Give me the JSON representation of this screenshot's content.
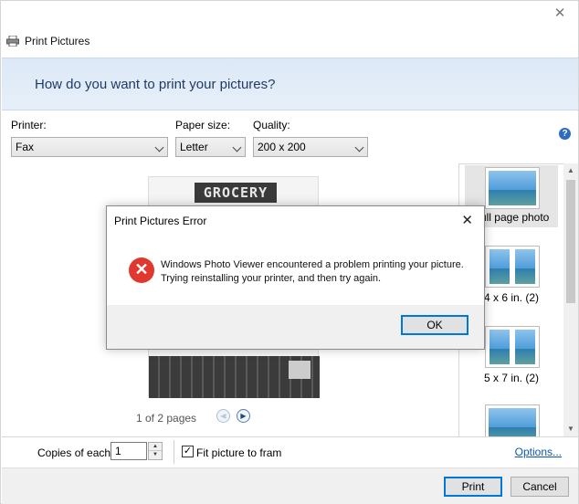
{
  "window": {
    "title": "Print Pictures",
    "close_glyph": "✕"
  },
  "banner": {
    "heading": "How do you want to print your pictures?"
  },
  "printer": {
    "label": "Printer:",
    "value": "Fax"
  },
  "paper_size": {
    "label": "Paper size:",
    "value": "Letter"
  },
  "quality": {
    "label": "Quality:",
    "value": "200 x 200"
  },
  "help": {
    "glyph": "?"
  },
  "preview": {
    "sign_text": "GROCERY",
    "page_info": "1 of 2 pages"
  },
  "layouts": [
    {
      "label": "Full page photo",
      "selected": true
    },
    {
      "label": "4 x 6 in. (2)",
      "selected": false
    },
    {
      "label": "5 x 7 in. (2)",
      "selected": false
    }
  ],
  "bottom": {
    "copies_label": "Copies of each",
    "copies_value": "1",
    "fit_label": "Fit picture to fram",
    "fit_checked": true,
    "options_link": "Options..."
  },
  "footer": {
    "print_label": "Print",
    "cancel_label": "Cancel"
  },
  "error_dialog": {
    "title": "Print Pictures Error",
    "message_line1": "Windows Photo Viewer encountered a problem printing your picture.",
    "message_line2": "Trying reinstalling your printer, and then try again.",
    "ok_label": "OK"
  },
  "colors": {
    "accent": "#0078d7",
    "error": "#e0382e",
    "banner_text": "#1e3b66",
    "link": "#0b57b0"
  }
}
